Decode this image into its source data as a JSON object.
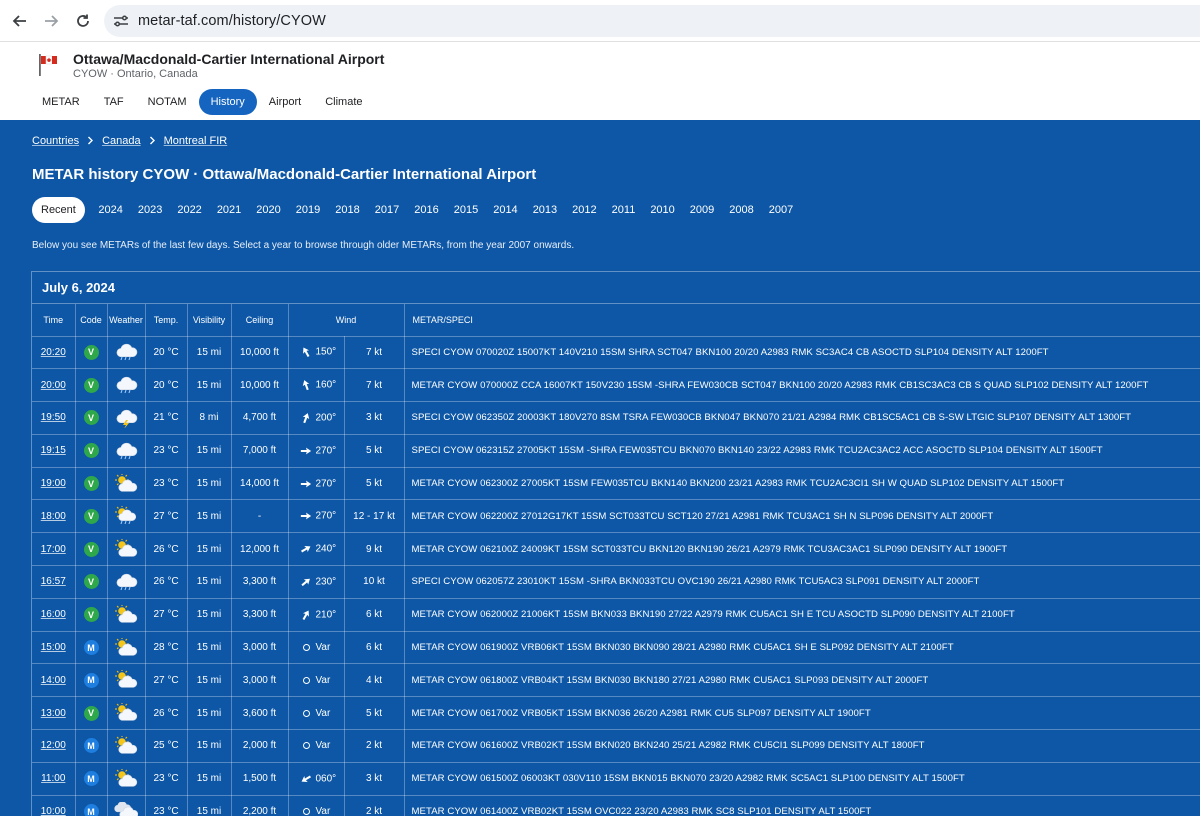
{
  "browser": {
    "url": "metar-taf.com/history/CYOW"
  },
  "header": {
    "airport_name": "Ottawa/Macdonald-Cartier International Airport",
    "airport_sub": "CYOW · Ontario, Canada",
    "nav": [
      "METAR",
      "TAF",
      "NOTAM",
      "History",
      "Airport",
      "Climate"
    ],
    "active_nav": "History"
  },
  "breadcrumb": [
    "Countries",
    "Canada",
    "Montreal FIR"
  ],
  "page_title": "METAR history CYOW · Ottawa/Macdonald-Cartier International Airport",
  "year_tabs": [
    "Recent",
    "2024",
    "2023",
    "2022",
    "2021",
    "2020",
    "2019",
    "2018",
    "2017",
    "2016",
    "2015",
    "2014",
    "2013",
    "2012",
    "2011",
    "2010",
    "2009",
    "2008",
    "2007"
  ],
  "active_year": "Recent",
  "info_text": "Below you see METARs of the last few days. Select a year to browse through older METARs, from the year 2007 onwards.",
  "table": {
    "date": "July 6, 2024",
    "columns": [
      "Time",
      "Code",
      "Weather",
      "Temp.",
      "Visibility",
      "Ceiling",
      "Wind",
      "METAR/SPECI"
    ],
    "rows": [
      {
        "time": "20:20",
        "code": "V",
        "weather": "rain-cloud-icon",
        "temp": "20 °C",
        "vis": "15 mi",
        "ceiling": "10,000 ft",
        "wind_deg": 150,
        "wind_dir": "150°",
        "wind_speed": "7 kt",
        "metar": "SPECI CYOW 070020Z 15007KT 140V210 15SM SHRA SCT047 BKN100 20/20 A2983 RMK SC3AC4 CB ASOCTD SLP104 DENSITY ALT 1200FT"
      },
      {
        "time": "20:00",
        "code": "V",
        "weather": "rain-cloud-icon",
        "temp": "20 °C",
        "vis": "15 mi",
        "ceiling": "10,000 ft",
        "wind_deg": 160,
        "wind_dir": "160°",
        "wind_speed": "7 kt",
        "metar": "METAR CYOW 070000Z CCA 16007KT 150V230 15SM -SHRA FEW030CB SCT047 BKN100 20/20 A2983 RMK CB1SC3AC3 CB S QUAD SLP102 DENSITY ALT 1200FT"
      },
      {
        "time": "19:50",
        "code": "V",
        "weather": "thunderstorm-icon",
        "temp": "21 °C",
        "vis": "8 mi",
        "ceiling": "4,700 ft",
        "wind_deg": 200,
        "wind_dir": "200°",
        "wind_speed": "3 kt",
        "metar": "SPECI CYOW 062350Z 20003KT 180V270 8SM TSRA FEW030CB BKN047 BKN070 21/21 A2984 RMK CB1SC5AC1 CB S-SW LTGIC SLP107 DENSITY ALT 1300FT"
      },
      {
        "time": "19:15",
        "code": "V",
        "weather": "rain-cloud-icon",
        "temp": "23 °C",
        "vis": "15 mi",
        "ceiling": "7,000 ft",
        "wind_deg": 270,
        "wind_dir": "270°",
        "wind_speed": "5 kt",
        "metar": "SPECI CYOW 062315Z 27005KT 15SM -SHRA FEW035TCU BKN070 BKN140 23/22 A2983 RMK TCU2AC3AC2 ACC ASOCTD SLP104 DENSITY ALT 1500FT"
      },
      {
        "time": "19:00",
        "code": "V",
        "weather": "sun-cloud-icon",
        "temp": "23 °C",
        "vis": "15 mi",
        "ceiling": "14,000 ft",
        "wind_deg": 270,
        "wind_dir": "270°",
        "wind_speed": "5 kt",
        "metar": "METAR CYOW 062300Z 27005KT 15SM FEW035TCU BKN140 BKN200 23/21 A2983 RMK TCU2AC3CI1 SH W QUAD SLP102 DENSITY ALT 1500FT"
      },
      {
        "time": "18:00",
        "code": "V",
        "weather": "sun-rain-icon",
        "temp": "27 °C",
        "vis": "15 mi",
        "ceiling": "-",
        "wind_deg": 270,
        "wind_dir": "270°",
        "wind_speed": "12 - 17 kt",
        "metar": "METAR CYOW 062200Z 27012G17KT 15SM SCT033TCU SCT120 27/21 A2981 RMK TCU3AC1 SH N SLP096 DENSITY ALT 2000FT"
      },
      {
        "time": "17:00",
        "code": "V",
        "weather": "sun-cloud-icon",
        "temp": "26 °C",
        "vis": "15 mi",
        "ceiling": "12,000 ft",
        "wind_deg": 240,
        "wind_dir": "240°",
        "wind_speed": "9 kt",
        "metar": "METAR CYOW 062100Z 24009KT 15SM SCT033TCU BKN120 BKN190 26/21 A2979 RMK TCU3AC3AC1 SLP090 DENSITY ALT 1900FT"
      },
      {
        "time": "16:57",
        "code": "V",
        "weather": "rain-cloud-icon",
        "temp": "26 °C",
        "vis": "15 mi",
        "ceiling": "3,300 ft",
        "wind_deg": 230,
        "wind_dir": "230°",
        "wind_speed": "10 kt",
        "metar": "SPECI CYOW 062057Z 23010KT 15SM -SHRA BKN033TCU OVC190 26/21 A2980 RMK TCU5AC3 SLP091 DENSITY ALT 2000FT"
      },
      {
        "time": "16:00",
        "code": "V",
        "weather": "sun-cloud-icon",
        "temp": "27 °C",
        "vis": "15 mi",
        "ceiling": "3,300 ft",
        "wind_deg": 210,
        "wind_dir": "210°",
        "wind_speed": "6 kt",
        "metar": "METAR CYOW 062000Z 21006KT 15SM BKN033 BKN190 27/22 A2979 RMK CU5AC1 SH E TCU ASOCTD SLP090 DENSITY ALT 2100FT"
      },
      {
        "time": "15:00",
        "code": "M",
        "weather": "sun-cloud-icon",
        "temp": "28 °C",
        "vis": "15 mi",
        "ceiling": "3,000 ft",
        "wind_deg": null,
        "wind_dir": "Var",
        "wind_speed": "6 kt",
        "metar": "METAR CYOW 061900Z VRB06KT 15SM BKN030 BKN090 28/21 A2980 RMK CU5AC1 SH E SLP092 DENSITY ALT 2100FT"
      },
      {
        "time": "14:00",
        "code": "M",
        "weather": "sun-cloud-icon",
        "temp": "27 °C",
        "vis": "15 mi",
        "ceiling": "3,000 ft",
        "wind_deg": null,
        "wind_dir": "Var",
        "wind_speed": "4 kt",
        "metar": "METAR CYOW 061800Z VRB04KT 15SM BKN030 BKN180 27/21 A2980 RMK CU5AC1 SLP093 DENSITY ALT 2000FT"
      },
      {
        "time": "13:00",
        "code": "V",
        "weather": "sun-cloud-icon",
        "temp": "26 °C",
        "vis": "15 mi",
        "ceiling": "3,600 ft",
        "wind_deg": null,
        "wind_dir": "Var",
        "wind_speed": "5 kt",
        "metar": "METAR CYOW 061700Z VRB05KT 15SM BKN036 26/20 A2981 RMK CU5 SLP097 DENSITY ALT 1900FT"
      },
      {
        "time": "12:00",
        "code": "M",
        "weather": "sun-cloud-icon",
        "temp": "25 °C",
        "vis": "15 mi",
        "ceiling": "2,000 ft",
        "wind_deg": null,
        "wind_dir": "Var",
        "wind_speed": "2 kt",
        "metar": "METAR CYOW 061600Z VRB02KT 15SM BKN020 BKN240 25/21 A2982 RMK CU5CI1 SLP099 DENSITY ALT 1800FT"
      },
      {
        "time": "11:00",
        "code": "M",
        "weather": "sun-cloud-icon",
        "temp": "23 °C",
        "vis": "15 mi",
        "ceiling": "1,500 ft",
        "wind_deg": 60,
        "wind_dir": "060°",
        "wind_speed": "3 kt",
        "metar": "METAR CYOW 061500Z 06003KT 030V110 15SM BKN015 BKN070 23/20 A2982 RMK SC5AC1 SLP100 DENSITY ALT 1500FT"
      },
      {
        "time": "10:00",
        "code": "M",
        "weather": "overcast-icon",
        "temp": "23 °C",
        "vis": "15 mi",
        "ceiling": "2,200 ft",
        "wind_deg": null,
        "wind_dir": "Var",
        "wind_speed": "2 kt",
        "metar": "METAR CYOW 061400Z VRB02KT 15SM OVC022 23/20 A2983 RMK SC8 SLP101 DENSITY ALT 1500FT"
      }
    ]
  },
  "colors": {
    "main_bg": "#0d57a6",
    "active_tab": "#1565c0",
    "vfr": "#2ea84a",
    "mvfr": "#1e7fe0"
  }
}
